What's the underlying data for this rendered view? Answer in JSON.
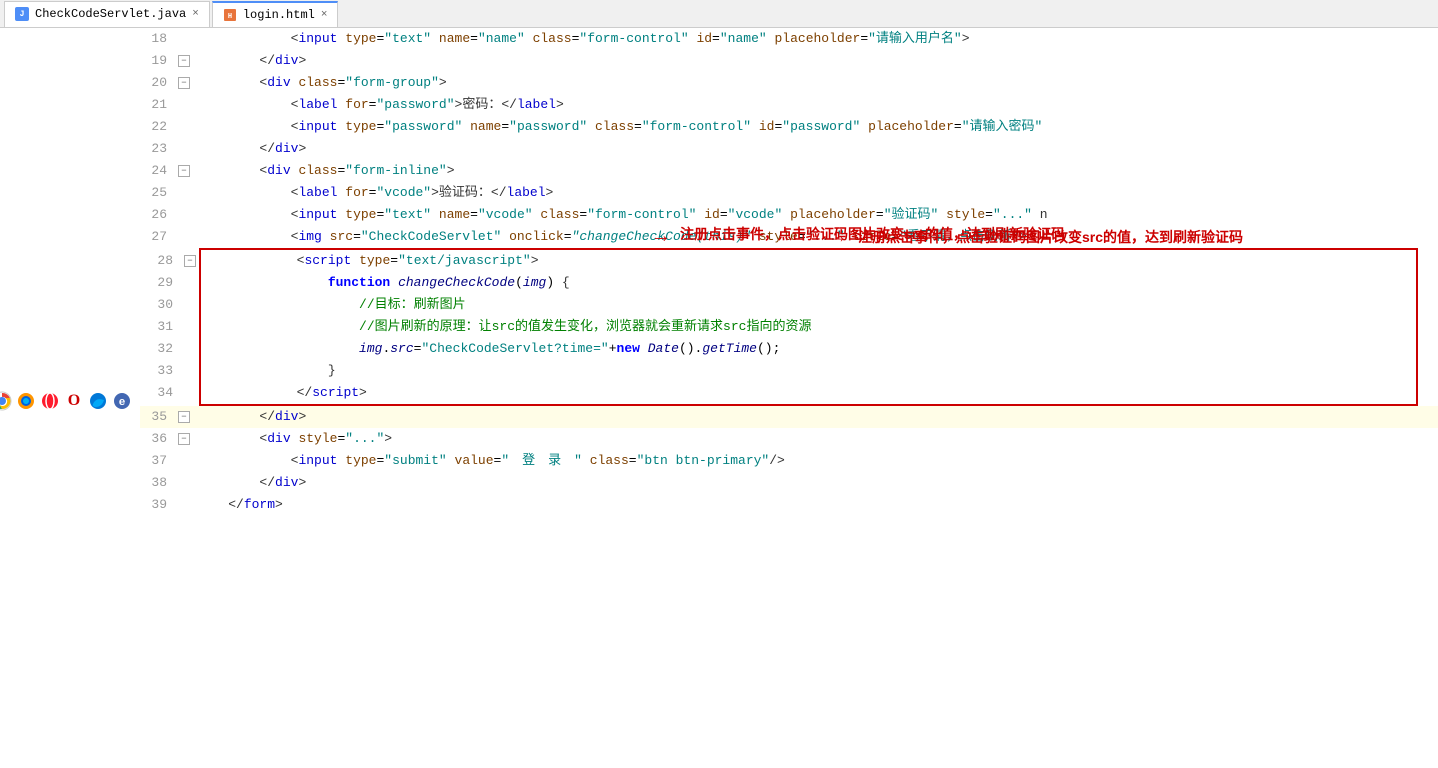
{
  "tabs": [
    {
      "id": "tab-java",
      "label": "CheckCodeServlet.java",
      "icon": "java",
      "active": false,
      "closable": true
    },
    {
      "id": "tab-html",
      "label": "login.html",
      "icon": "html",
      "active": true,
      "closable": true
    }
  ],
  "lines": [
    {
      "num": 18,
      "fold": null,
      "highlighted": false,
      "code": "            <span class='c-punct'>&lt;</span><span class='c-tag'>input</span> <span class='c-attr'>type</span>=<span class='c-string'>\"text\"</span> <span class='c-attr'>name</span>=<span class='c-string'>\"name\"</span> <span class='c-attr'>class</span>=<span class='c-string'>\"form-control\"</span> <span class='c-attr'>id</span>=<span class='c-string'>\"name\"</span> <span class='c-attr'>placeholder</span>=<span class='c-string'>\"请输入用户名\"</span><span class='c-punct'>&gt;</span>"
    },
    {
      "num": 19,
      "fold": null,
      "highlighted": false,
      "code": "        <span class='c-punct'>&lt;/</span><span class='c-tag'>div</span><span class='c-punct'>&gt;</span>"
    },
    {
      "num": 20,
      "fold": "-",
      "highlighted": false,
      "code": "        <span class='c-punct'>&lt;</span><span class='c-tag'>div</span> <span class='c-attr'>class</span>=<span class='c-string'>\"form-group\"</span><span class='c-punct'>&gt;</span>"
    },
    {
      "num": 21,
      "fold": null,
      "highlighted": false,
      "code": "            <span class='c-punct'>&lt;</span><span class='c-tag'>label</span> <span class='c-attr'>for</span>=<span class='c-string'>\"password\"</span><span class='c-punct'>&gt;</span><span class='c-cn'>密码：</span><span class='c-punct'>&lt;/</span><span class='c-tag'>label</span><span class='c-punct'>&gt;</span>"
    },
    {
      "num": 22,
      "fold": null,
      "highlighted": false,
      "code": "            <span class='c-punct'>&lt;</span><span class='c-tag'>input</span> <span class='c-attr'>type</span>=<span class='c-string'>\"password\"</span> <span class='c-attr'>name</span>=<span class='c-string'>\"password\"</span> <span class='c-attr'>class</span>=<span class='c-string'>\"form-control\"</span> <span class='c-attr'>id</span>=<span class='c-string'>\"password\"</span> <span class='c-attr'>placeholder</span>=<span class='c-string'>\"请输入密码\"</span>"
    },
    {
      "num": 23,
      "fold": null,
      "highlighted": false,
      "code": "        <span class='c-punct'>&lt;/</span><span class='c-tag'>div</span><span class='c-punct'>&gt;</span>"
    },
    {
      "num": 24,
      "fold": "-",
      "highlighted": false,
      "code": "        <span class='c-punct'>&lt;</span><span class='c-tag'>div</span> <span class='c-attr'>class</span>=<span class='c-string'>\"form-inline\"</span><span class='c-punct'>&gt;</span>"
    },
    {
      "num": 25,
      "fold": null,
      "highlighted": false,
      "code": "            <span class='c-punct'>&lt;</span><span class='c-tag'>label</span> <span class='c-attr'>for</span>=<span class='c-string'>\"vcode\"</span><span class='c-punct'>&gt;</span><span class='c-cn'>验证码：</span><span class='c-punct'>&lt;/</span><span class='c-tag'>label</span><span class='c-punct'>&gt;</span>"
    },
    {
      "num": 26,
      "fold": null,
      "highlighted": false,
      "code": "            <span class='c-punct'>&lt;</span><span class='c-tag'>input</span> <span class='c-attr'>type</span>=<span class='c-string'>\"text\"</span> <span class='c-attr'>name</span>=<span class='c-string'>\"vcode\"</span> <span class='c-attr'>class</span>=<span class='c-string'>\"form-control\"</span> <span class='c-attr'>id</span>=<span class='c-string'>\"vcode\"</span> <span class='c-attr'>placeholder</span>=<span class='c-string'>\"验证码\"</span> <span class='c-attr'>style</span>=<span class='c-string'>\"...\"</span> <span class='c-cn'>n</span>"
    },
    {
      "num": 27,
      "fold": null,
      "highlighted": false,
      "code": "            <span class='c-punct'>&lt;</span><span class='c-tag'>img</span> <span class='c-attr'>src</span>=<span class='c-string'>\"CheckCodeServlet\"</span> <span class='c-attr'>onclick</span>=<span class='c-string'><em>\"changeCheckCode(this)\"</em></span> <span class='c-attr'>style</span>=<span class='c-string'>\"...\"</span> <span class='c-attr'>title</span>=<span class='c-string'>\"看不清，点击刷新\"</span><span class='c-punct'>&gt;</span>"
    },
    {
      "num": 28,
      "fold": "-",
      "highlighted": false,
      "code": "            <span class='c-punct'>&lt;</span><span class='c-tag'>script</span> <span class='c-attr'>type</span>=<span class='c-string'>\"text/javascript\"</span><span class='c-punct'>&gt;</span>"
    },
    {
      "num": 29,
      "fold": null,
      "highlighted": false,
      "code": "                <span class='c-keyword'>function</span> <span class='c-function'><em>changeCheckCode</em></span>(<span class='c-function'><em>img</em></span>) <span class='c-punct'>{</span>"
    },
    {
      "num": 30,
      "fold": null,
      "highlighted": false,
      "code": "                    <span class='c-comment'>//目标：刷新图片</span>"
    },
    {
      "num": 31,
      "fold": null,
      "highlighted": false,
      "code": "                    <span class='c-comment'>//图片刷新的原理：让src的值发生变化，浏览器就会重新请求src指向的资源</span>"
    },
    {
      "num": 32,
      "fold": null,
      "highlighted": false,
      "code": "                    <span class='c-function'><em>img</em></span>.<span class='c-function'><em>src</em></span>=<span class='c-string'>\"CheckCodeServlet?time=\"</span>+<span class='c-keyword'>new</span> <span class='c-function'><em>Date</em></span>().<span class='c-function'><em>getTime</em></span>();"
    },
    {
      "num": 33,
      "fold": null,
      "highlighted": false,
      "code": "                <span class='c-punct'>}</span>"
    },
    {
      "num": 34,
      "fold": null,
      "highlighted": false,
      "code": "            <span class='c-punct'>&lt;/</span><span class='c-tag'>script</span><span class='c-punct'>&gt;</span>"
    },
    {
      "num": 35,
      "fold": null,
      "highlighted": true,
      "code": "        <span class='c-punct'>&lt;/</span><span class='c-tag'>div</span><span class='c-punct'>&gt;</span>"
    },
    {
      "num": 36,
      "fold": "-",
      "highlighted": false,
      "code": "        <span class='c-punct'>&lt;</span><span class='c-tag'>div</span> <span class='c-attr'>style</span>=<span class='c-string'>\"...\"</span><span class='c-punct'>&gt;</span>"
    },
    {
      "num": 37,
      "fold": null,
      "highlighted": false,
      "code": "            <span class='c-punct'>&lt;</span><span class='c-tag'>input</span> <span class='c-attr'>type</span>=<span class='c-string'>\"submit\"</span> <span class='c-attr'>value</span>=<span class='c-string'>\"　登　录　\"</span> <span class='c-attr'>class</span>=<span class='c-string'>\"btn btn-primary\"</span><span class='c-punct'>/&gt;</span>"
    },
    {
      "num": 38,
      "fold": null,
      "highlighted": false,
      "code": "        <span class='c-punct'>&lt;/</span><span class='c-tag'>div</span><span class='c-punct'>&gt;</span>"
    },
    {
      "num": 39,
      "fold": null,
      "highlighted": false,
      "code": "    <span class='c-punct'>&lt;/</span><span class='c-tag'>form</span><span class='c-punct'>&gt;</span>"
    }
  ],
  "annotation": {
    "text": "注册点击事件，点击验证码图片改变src的值，达到刷新验证码",
    "arrow": "→"
  },
  "browser_icons": [
    "🌐",
    "🦊",
    "🔴",
    "⭕",
    "🌍",
    "🔵"
  ]
}
